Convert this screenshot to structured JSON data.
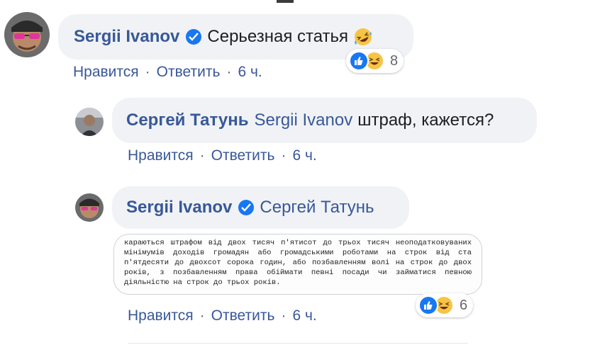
{
  "comments": [
    {
      "author": "Sergii Ivanov",
      "verified": true,
      "mention": "",
      "text": "Серьезная статья",
      "emoji": "rolling-on-the-floor-laughing",
      "reactions": {
        "types": [
          "like",
          "haha"
        ],
        "count": "8"
      },
      "actions": {
        "like": "Нравится",
        "reply": "Ответить",
        "time": "6 ч."
      }
    },
    {
      "author": "Сергей Татунь",
      "verified": false,
      "mention": "Sergii Ivanov",
      "text": "штраф, кажется?",
      "actions": {
        "like": "Нравится",
        "reply": "Ответить",
        "time": "6 ч."
      }
    },
    {
      "author": "Sergii Ivanov",
      "verified": true,
      "mention": "Сергей Татунь",
      "text": "",
      "attachment_text": "караються штрафом від двох тисяч п'ятисот до трьох тисяч неоподатковуваних мінімумів доходів громадян або громадськими роботами на строк від ста п'ятдесяти до двохсот сорока годин, або позбавленням волі на строк до двох років, з позбавленням права обіймати певні посади чи займатися певною діяльністю на строк до трьох років.",
      "reactions": {
        "types": [
          "like",
          "haha"
        ],
        "count": "6"
      },
      "actions": {
        "like": "Нравится",
        "reply": "Ответить",
        "time": "6 ч."
      }
    }
  ],
  "separator": "·",
  "colors": {
    "link": "#385898",
    "bubble": "#f0f2f5",
    "meta": "#65676b",
    "like": "#1877f2",
    "haha": "#f7c444"
  }
}
